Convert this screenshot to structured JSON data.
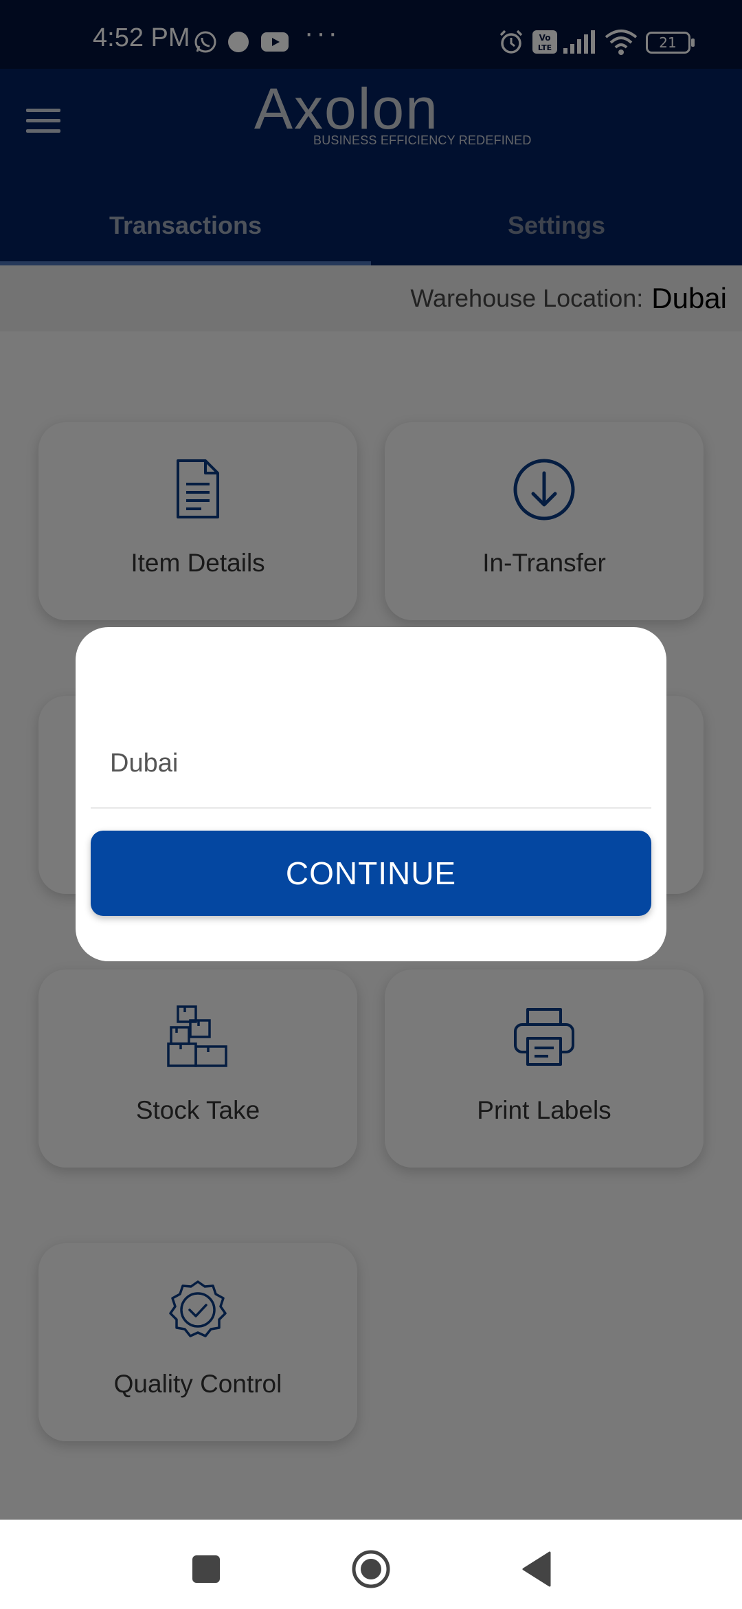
{
  "status_bar": {
    "time": "4:52 PM",
    "battery": "21",
    "icons": [
      "whatsapp-icon",
      "circle-icon",
      "youtube-icon",
      "more-dots-icon",
      "alarm-icon",
      "volte-icon",
      "signal-icon",
      "wifi-icon",
      "battery-icon"
    ]
  },
  "header": {
    "logo_text": "Axolon",
    "logo_tagline": "BUSINESS EFFICIENCY REDEFINED",
    "menu_icon": "hamburger-menu-icon"
  },
  "tabs": [
    {
      "label": "Transactions",
      "active": true
    },
    {
      "label": "Settings",
      "active": false
    }
  ],
  "location": {
    "label": "Warehouse Location:",
    "value": "Dubai"
  },
  "tiles": [
    {
      "label": "Item Details",
      "icon": "document-icon"
    },
    {
      "label": "In-Transfer",
      "icon": "download-circle-icon"
    },
    {
      "label": "Stock Take",
      "icon": "boxes-icon"
    },
    {
      "label": "Print Labels",
      "icon": "printer-icon"
    },
    {
      "label": "Quality Control",
      "icon": "badge-check-icon"
    }
  ],
  "dialog": {
    "selected_value": "Dubai",
    "button_label": "CONTINUE"
  },
  "nav_bar": {
    "icons": [
      "recents-square-icon",
      "home-circle-icon",
      "back-triangle-icon"
    ]
  },
  "colors": {
    "status_bar": "#02133b",
    "app_bar": "#02215f",
    "primary_button": "#0447a1",
    "icon_blue": "#0a3a82"
  }
}
